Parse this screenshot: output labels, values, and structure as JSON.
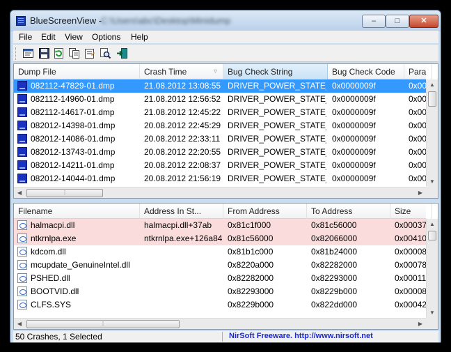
{
  "window": {
    "title": "BlueScreenView",
    "title_sep": " - ",
    "title_path": "C:\\Users\\abc\\Desktop\\Minidump",
    "min_glyph": "–",
    "max_glyph": "□",
    "close_glyph": "✕"
  },
  "menu": [
    "File",
    "Edit",
    "View",
    "Options",
    "Help"
  ],
  "toolbar": {
    "icons": [
      "html-report-icon",
      "save-icon",
      "refresh-icon",
      "copy-icon",
      "properties-icon",
      "find-icon",
      "exit-icon"
    ]
  },
  "crashes": {
    "columns": [
      "Dump File",
      "Crash Time",
      "Bug Check String",
      "Bug Check Code",
      "Para"
    ],
    "sorted_column": "Bug Check String",
    "sort_indicator_column": "Crash Time",
    "rows": [
      {
        "file": "082112-47829-01.dmp",
        "time": "21.08.2012 13:08:55",
        "string": "DRIVER_POWER_STATE_...",
        "code": "0x0000009f",
        "param": "0x00"
      },
      {
        "file": "082112-14960-01.dmp",
        "time": "21.08.2012 12:56:52",
        "string": "DRIVER_POWER_STATE_...",
        "code": "0x0000009f",
        "param": "0x00"
      },
      {
        "file": "082112-14617-01.dmp",
        "time": "21.08.2012 12:45:22",
        "string": "DRIVER_POWER_STATE_...",
        "code": "0x0000009f",
        "param": "0x00"
      },
      {
        "file": "082012-14398-01.dmp",
        "time": "20.08.2012 22:45:29",
        "string": "DRIVER_POWER_STATE_...",
        "code": "0x0000009f",
        "param": "0x00"
      },
      {
        "file": "082012-14086-01.dmp",
        "time": "20.08.2012 22:33:11",
        "string": "DRIVER_POWER_STATE_...",
        "code": "0x0000009f",
        "param": "0x00"
      },
      {
        "file": "082012-13743-01.dmp",
        "time": "20.08.2012 22:20:55",
        "string": "DRIVER_POWER_STATE_...",
        "code": "0x0000009f",
        "param": "0x00"
      },
      {
        "file": "082012-14211-01.dmp",
        "time": "20.08.2012 22:08:37",
        "string": "DRIVER_POWER_STATE_...",
        "code": "0x0000009f",
        "param": "0x00"
      },
      {
        "file": "082012-14044-01.dmp",
        "time": "20.08.2012 21:56:19",
        "string": "DRIVER_POWER_STATE_...",
        "code": "0x0000009f",
        "param": "0x00"
      }
    ],
    "selected_index": 0
  },
  "modules": {
    "columns": [
      "Filename",
      "Address In St...",
      "From Address",
      "To Address",
      "Size"
    ],
    "rows": [
      {
        "file": "halmacpi.dll",
        "addr": "halmacpi.dll+37ab",
        "from": "0x81c1f000",
        "to": "0x81c56000",
        "size": "0x00037",
        "highlight": true
      },
      {
        "file": "ntkrnlpa.exe",
        "addr": "ntkrnlpa.exe+126a84",
        "from": "0x81c56000",
        "to": "0x82066000",
        "size": "0x00410",
        "highlight": true
      },
      {
        "file": "kdcom.dll",
        "addr": "",
        "from": "0x81b1c000",
        "to": "0x81b24000",
        "size": "0x00008",
        "highlight": false
      },
      {
        "file": "mcupdate_GenuineIntel.dll",
        "addr": "",
        "from": "0x8220a000",
        "to": "0x82282000",
        "size": "0x00078",
        "highlight": false
      },
      {
        "file": "PSHED.dll",
        "addr": "",
        "from": "0x82282000",
        "to": "0x82293000",
        "size": "0x00011",
        "highlight": false
      },
      {
        "file": "BOOTVID.dll",
        "addr": "",
        "from": "0x82293000",
        "to": "0x8229b000",
        "size": "0x00008",
        "highlight": false
      },
      {
        "file": "CLFS.SYS",
        "addr": "",
        "from": "0x8229b000",
        "to": "0x822dd000",
        "size": "0x00042",
        "highlight": false
      }
    ]
  },
  "status": {
    "count": "50 Crashes, 1 Selected",
    "credit": "NirSoft Freeware.  http://www.nirsoft.net"
  },
  "colors": {
    "selection": "#3399ff",
    "highlight_row": "#fadcdc",
    "credit_text": "#1a2ad0"
  }
}
